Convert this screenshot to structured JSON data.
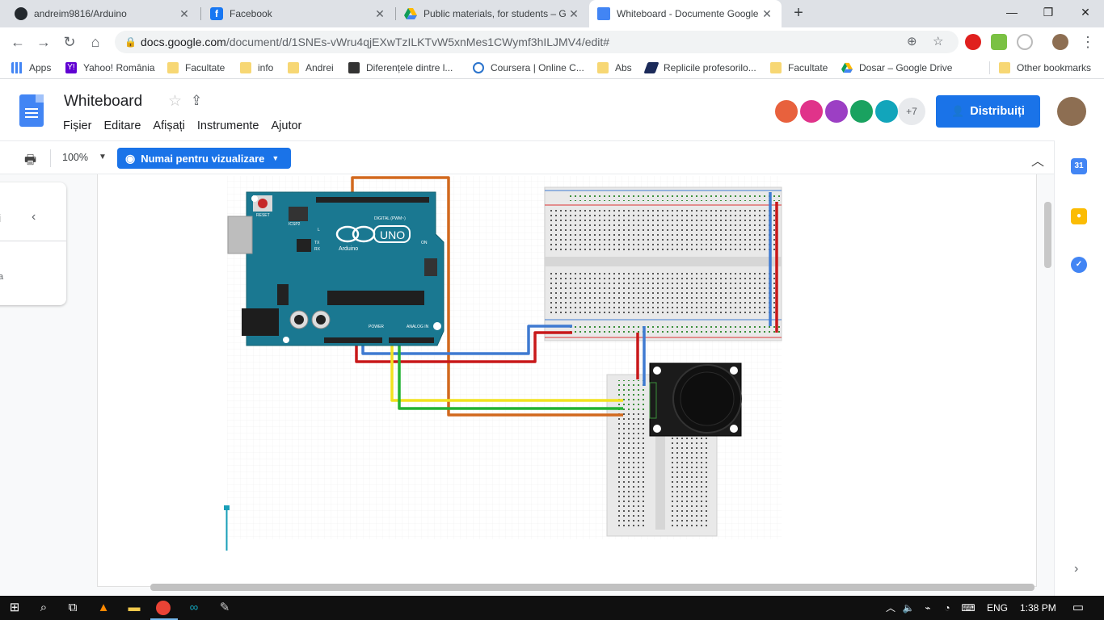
{
  "browser": {
    "tabs": [
      {
        "title": "andreim9816/Arduino",
        "icon": "github-icon",
        "color": "#24292e"
      },
      {
        "title": "Facebook",
        "icon": "facebook-icon",
        "color": "#1877f2"
      },
      {
        "title": "Public materials, for students – G",
        "icon": "drive-icon",
        "color": "#0f9d58"
      },
      {
        "title": "Whiteboard - Documente Google",
        "icon": "docs-icon",
        "color": "#4285f4"
      }
    ],
    "close_glyph": "✕",
    "new_tab_glyph": "+",
    "window_controls": {
      "minimize": "—",
      "maximize": "❐",
      "close": "✕"
    },
    "url_host": "docs.google.com",
    "url_path": "/document/d/1SNEs-vWru4qjEXwTzILKTvW5xnMes1CWymf3hILJMV4/edit#",
    "bookmarks": [
      {
        "label": "Apps",
        "icon": "apps-grid-icon"
      },
      {
        "label": "Yahoo! România",
        "icon": "yahoo-icon"
      },
      {
        "label": "Facultate",
        "icon": "folder-icon"
      },
      {
        "label": "info",
        "icon": "folder-icon"
      },
      {
        "label": "Andrei",
        "icon": "folder-icon"
      },
      {
        "label": "Diferențele dintre l...",
        "icon": "page-icon"
      },
      {
        "label": "Coursera | Online C...",
        "icon": "coursera-icon"
      },
      {
        "label": "Abs",
        "icon": "folder-icon"
      },
      {
        "label": "Replicile profesorilo...",
        "icon": "graduation-icon"
      },
      {
        "label": "Facultate",
        "icon": "folder-icon"
      },
      {
        "label": "Dosar – Google Drive",
        "icon": "drive-icon"
      },
      {
        "label": "Other bookmarks",
        "icon": "folder-icon"
      }
    ]
  },
  "docs": {
    "title": "Whiteboard",
    "menu": [
      "Fișier",
      "Editare",
      "Afișați",
      "Instrumente",
      "Ajutor"
    ],
    "collaborators_extra": "+7",
    "share_label": "Distribuiți",
    "zoom": "100%",
    "mode_label": "Numai pentru vizualizare",
    "outline_initial": "i",
    "outline_snippet": "a",
    "collaborator_colors": [
      "#e8613d",
      "#e0338a",
      "#9c3fc4",
      "#1aa260",
      "#12a5bb"
    ]
  },
  "diagram": {
    "board_labels": {
      "uno": "UNO",
      "brand": "Arduino",
      "reset": "RESET",
      "icsp": "ICSP2",
      "digital": "DIGITAL (PWM~)",
      "power": "POWER",
      "analog": "ANALOG IN",
      "on": "ON",
      "tx": "TX",
      "rx": "RX",
      "l": "L"
    },
    "wire_colors": {
      "orange": "#d2691e",
      "blue": "#3f7ad1",
      "red": "#c8181a",
      "yellow": "#f2e21f",
      "green": "#24b233"
    }
  },
  "taskbar": {
    "language": "ENG",
    "time": "1:38 PM"
  }
}
